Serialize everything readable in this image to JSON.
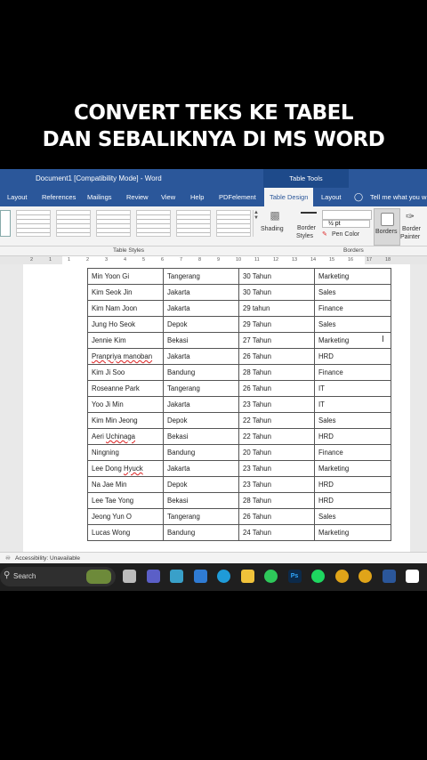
{
  "caption": {
    "line1": "CONVERT TEKS KE TABEL",
    "line2": "DAN SEBALIKNYA DI MS WORD"
  },
  "window": {
    "title": "Document1 [Compatibility Mode]  -  Word",
    "context_tab": "Table Tools"
  },
  "tabs": [
    "Layout",
    "References",
    "Mailings",
    "Review",
    "View",
    "Help",
    "PDFelement",
    "Table Design",
    "Layout"
  ],
  "tell_me": "Tell me what you w",
  "ribbon": {
    "shading": "Shading",
    "border_styles_1": "Border",
    "border_styles_2": "Styles",
    "pen_weight": "½ pt",
    "pen_color": "Pen Color",
    "borders": "Borders",
    "border_painter_1": "Border",
    "border_painter_2": "Painter",
    "group_table_styles": "Table Styles",
    "group_borders": "Borders"
  },
  "ruler_marks": [
    "2",
    "1",
    "1",
    "2",
    "3",
    "4",
    "5",
    "6",
    "7",
    "8",
    "9",
    "10",
    "11",
    "12",
    "13",
    "14",
    "15",
    "16",
    "17",
    "18"
  ],
  "table": {
    "rows": [
      [
        "Min Yoon Gi",
        "Tangerang",
        "30 Tahun",
        "Marketing"
      ],
      [
        "Kim Seok Jin",
        "Jakarta",
        "30 Tahun",
        "Sales"
      ],
      [
        "Kim Nam Joon",
        "Jakarta",
        "29 tahun",
        "Finance"
      ],
      [
        "Jung Ho Seok",
        "Depok",
        "29 Tahun",
        "Sales"
      ],
      [
        "Jennie Kim",
        "Bekasi",
        "27 Tahun",
        "Marketing"
      ],
      [
        "Pranpriya manoban",
        "Jakarta",
        "26 Tahun",
        "HRD"
      ],
      [
        "Kim Ji Soo",
        "Bandung",
        "28 Tahun",
        "Finance"
      ],
      [
        "Roseanne Park",
        "Tangerang",
        "26 Tahun",
        "IT"
      ],
      [
        "Yoo Ji Min",
        "Jakarta",
        "23 Tahun",
        "IT"
      ],
      [
        "Kim Min Jeong",
        "Depok",
        "22 Tahun",
        "Sales"
      ],
      [
        "Aeri Uchinaga",
        "Bekasi",
        "22 Tahun",
        "HRD"
      ],
      [
        "Ningning",
        "Bandung",
        "20 Tahun",
        "Finance"
      ],
      [
        "Lee Dong Hyuck",
        "Jakarta",
        "23 Tahun",
        "Marketing"
      ],
      [
        "Na Jae Min",
        "Depok",
        "23 Tahun",
        "HRD"
      ],
      [
        "Lee Tae Yong",
        "Bekasi",
        "28 Tahun",
        "HRD"
      ],
      [
        "Jeong Yun O",
        "Tangerang",
        "26 Tahun",
        "Sales"
      ],
      [
        "Lucas Wong",
        "Bandung",
        "24 Tahun",
        "Marketing"
      ]
    ]
  },
  "status": {
    "accessibility": "Accessibility: Unavailable"
  },
  "taskbar": {
    "search_placeholder": "Search",
    "icons": [
      "task-view-icon",
      "teams-icon",
      "l-app-icon",
      "mail-icon",
      "edge-icon",
      "file-explorer-icon",
      "whatsapp-icon",
      "photoshop-icon",
      "spotify-icon",
      "chrome-icon",
      "chrome-icon",
      "word-icon",
      "capcut-icon"
    ],
    "ps_label": "Ps"
  },
  "colors": {
    "word_blue": "#2b579a",
    "taskbar": "#1f1f1f"
  }
}
